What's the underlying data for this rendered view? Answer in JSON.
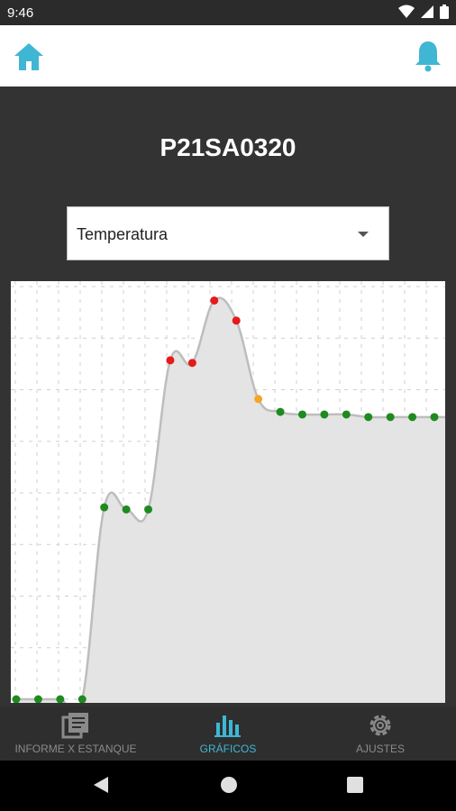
{
  "status": {
    "time": "9:46"
  },
  "header": {
    "home_icon": "home-icon",
    "bell_icon": "bell-icon",
    "accent": "#3fb6d4"
  },
  "page": {
    "title": "P21SA0320"
  },
  "selector": {
    "value": "Temperatura"
  },
  "chart_data": {
    "type": "line",
    "title": "",
    "xlabel": "",
    "ylabel": "",
    "grid": true,
    "x": [
      1,
      2,
      3,
      4,
      5,
      6,
      7,
      8,
      9,
      10,
      11,
      12,
      13,
      14,
      15,
      16,
      17,
      18,
      19,
      20
    ],
    "values": [
      0,
      0,
      0,
      0,
      3.72,
      3.68,
      3.68,
      6.57,
      6.52,
      7.73,
      7.34,
      5.82,
      5.57,
      5.52,
      5.52,
      5.52,
      5.47,
      5.47,
      5.47,
      5.47
    ],
    "point_colors": [
      "#1f8a1f",
      "#1f8a1f",
      "#1f8a1f",
      "#1f8a1f",
      "#1f8a1f",
      "#1f8a1f",
      "#1f8a1f",
      "#e51a1a",
      "#e51a1a",
      "#e51a1a",
      "#e51a1a",
      "#f5a623",
      "#1f8a1f",
      "#1f8a1f",
      "#1f8a1f",
      "#1f8a1f",
      "#1f8a1f",
      "#1f8a1f",
      "#1f8a1f",
      "#1f8a1f"
    ],
    "ylim": [
      0,
      8
    ]
  },
  "bottom_nav": {
    "items": [
      {
        "label": "INFORME X ESTANQUE",
        "icon": "report-icon"
      },
      {
        "label": "GRÁFICOS",
        "icon": "bar-chart-icon"
      },
      {
        "label": "AJUSTES",
        "icon": "gear-icon"
      }
    ],
    "active_color": "#3fb6d4"
  },
  "system_nav": {
    "back_icon": "back-icon",
    "home_icon": "circle-home-icon",
    "recents_icon": "recents-icon"
  }
}
